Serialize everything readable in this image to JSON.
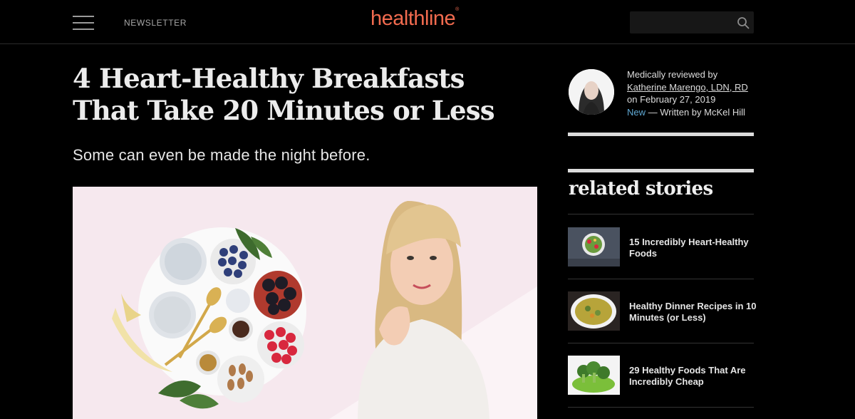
{
  "header": {
    "newsletter_label": "NEWSLETTER",
    "logo_text": "healthline",
    "logo_mark": "®",
    "search_placeholder": "",
    "brand_color": "#f26b4f"
  },
  "article": {
    "headline": "4 Heart-Healthy Breakfasts That Take 20 Minutes or Less",
    "subhead": "Some can even be made the night before."
  },
  "byline": {
    "reviewed_prefix": "Medically reviewed by",
    "reviewer": "Katherine Marengo, LDN, RD",
    "date_text": "on February 27, 2019",
    "new_label": "New",
    "written_text": "— Written by McKel Hill"
  },
  "related": {
    "title": "related stories",
    "items": [
      {
        "label": "15 Incredibly Heart-Healthy Foods"
      },
      {
        "label": "Healthy Dinner Recipes in 10 Minutes (or Less)"
      },
      {
        "label": "29 Healthy Foods That Are Incredibly Cheap"
      }
    ]
  }
}
